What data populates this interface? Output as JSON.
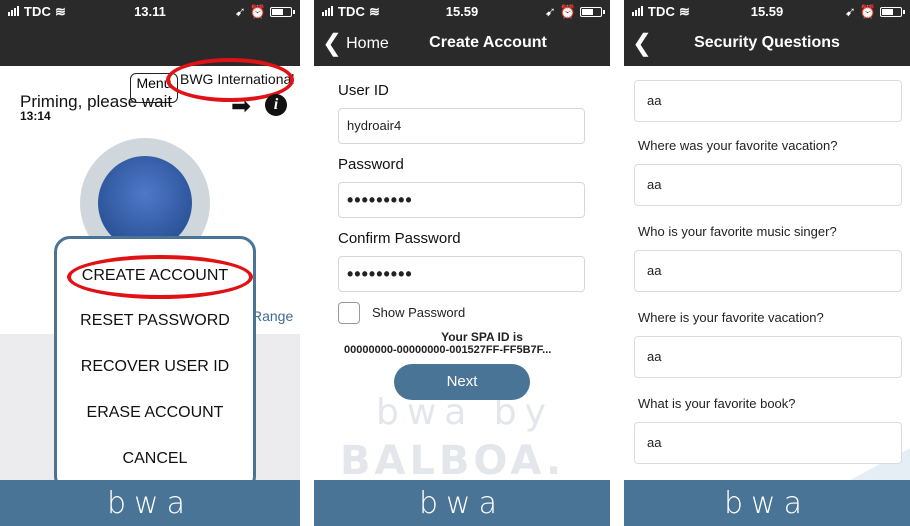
{
  "screens": [
    {
      "status": {
        "carrier": "TDC",
        "time": "13.11"
      },
      "title": "BWG International",
      "menu_label": "Menu",
      "status_text": "Priming, please wait",
      "timer": "13:14",
      "range_text": "Range",
      "popup_items": [
        "CREATE ACCOUNT",
        "RESET PASSWORD",
        "RECOVER USER ID",
        "ERASE ACCOUNT",
        "CANCEL"
      ],
      "footer_logo": "bwa",
      "annotation_color": "#e01216"
    },
    {
      "status": {
        "carrier": "TDC",
        "time": "15.59"
      },
      "back_label": "Home",
      "title": "Create Account",
      "fields": [
        {
          "label": "User ID",
          "value": "hydroair4"
        },
        {
          "label": "Password",
          "value": "•••••••••"
        },
        {
          "label": "Confirm Password",
          "value": "•••••••••"
        }
      ],
      "show_password_label": "Show Password",
      "spa_id_label": "Your SPA ID is",
      "spa_id_value": "00000000-00000000-001527FF-FF5B7F...",
      "next_label": "Next",
      "watermark": [
        "bwa by",
        "BALBOA."
      ],
      "footer_logo": "bwa"
    },
    {
      "status": {
        "carrier": "TDC",
        "time": "15.59"
      },
      "title": "Security Questions",
      "first_answer": "aa",
      "questions": [
        {
          "question": "Where was your favorite vacation?",
          "answer": "aa"
        },
        {
          "question": "Who is your favorite music singer?",
          "answer": "aa"
        },
        {
          "question": "Where is your favorite vacation?",
          "answer": "aa"
        },
        {
          "question": "What is your favorite book?",
          "answer": "aa"
        }
      ],
      "footer_logo": "bwa"
    }
  ],
  "theme": {
    "bar": "#2a2a2a",
    "accent": "#4a7496"
  }
}
